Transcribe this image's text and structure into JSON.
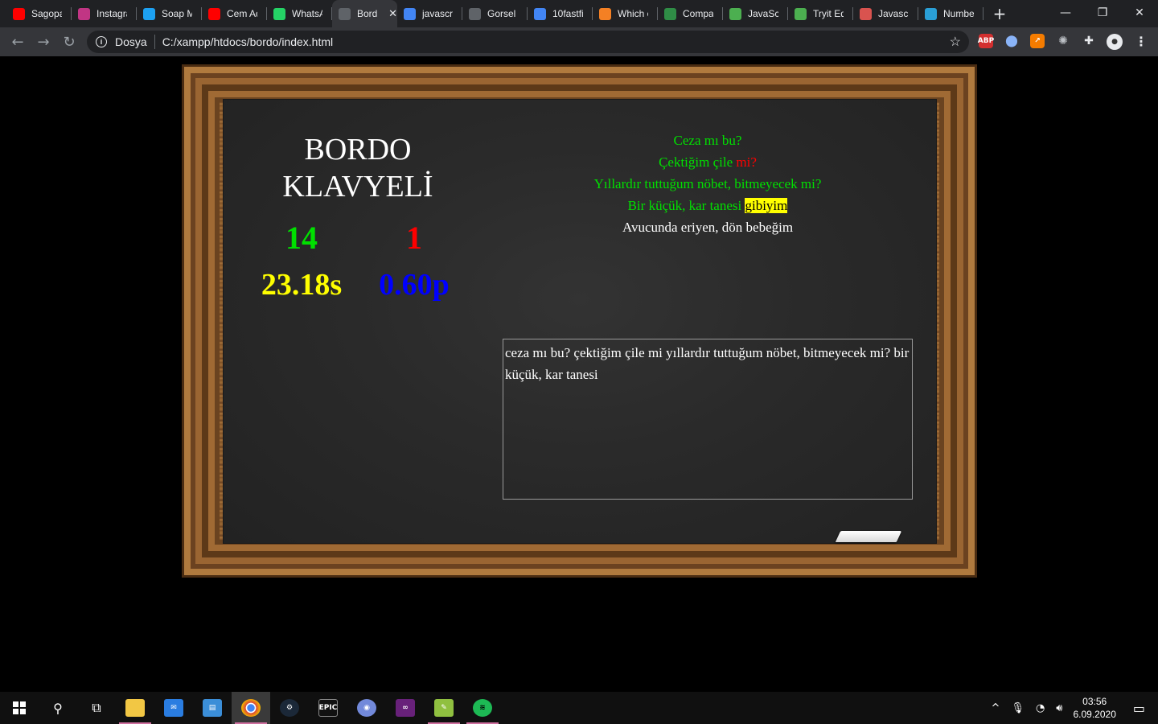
{
  "browser": {
    "tabs": [
      {
        "title": "Sagopa",
        "icon": "youtube-icon",
        "color": "#ff0000"
      },
      {
        "title": "Instagra",
        "icon": "instagram-icon",
        "color": "#c13584"
      },
      {
        "title": "Soap M",
        "icon": "twitter-icon",
        "color": "#1da1f2"
      },
      {
        "title": "Cem Ad",
        "icon": "youtube-icon",
        "color": "#ff0000"
      },
      {
        "title": "WhatsA",
        "icon": "whatsapp-icon",
        "color": "#25d366"
      },
      {
        "title": "Bord",
        "icon": "globe-icon",
        "color": "#5f6368",
        "active": true
      },
      {
        "title": "javascrip",
        "icon": "google-icon",
        "color": "#4285f4"
      },
      {
        "title": "Gorsel I",
        "icon": "globe-icon",
        "color": "#5f6368"
      },
      {
        "title": "10fastfi",
        "icon": "google-icon",
        "color": "#4285f4"
      },
      {
        "title": "Which c",
        "icon": "stackoverflow-icon",
        "color": "#f48024"
      },
      {
        "title": "Compa",
        "icon": "geeksforgeeks-icon",
        "color": "#2f8d46"
      },
      {
        "title": "JavaScri",
        "icon": "w3schools-icon",
        "color": "#4caf50"
      },
      {
        "title": "Tryit Ed",
        "icon": "w3schools-icon",
        "color": "#4caf50"
      },
      {
        "title": "Javascri",
        "icon": "tutorial-icon",
        "color": "#d9534f"
      },
      {
        "title": "Numbe",
        "icon": "numbers-icon",
        "color": "#2a9fd6"
      }
    ],
    "new_tab": "+",
    "window_controls": {
      "minimize": "—",
      "restore": "❐",
      "close": "✕"
    },
    "address": {
      "scheme_label": "Dosya",
      "url": "C:/xampp/htdocs/bordo/index.html"
    },
    "extensions": {
      "abp": "ABP"
    }
  },
  "game": {
    "title_line1": "BORDO",
    "title_line2": "KLAVYELİ",
    "correct_count": "14",
    "wrong_count": "1",
    "elapsed_time": "23.18s",
    "score": "0.60p"
  },
  "poem": {
    "line1": "Ceza mı bu?",
    "line2_a": "Çektiğim çile",
    "line2_b": "mi?",
    "line3": "Yıllardır tuttuğum nöbet, bitmeyecek mi?",
    "line4_a": "Bir küçük, kar tanesi",
    "line4_b": "gibiyim",
    "line5": "Avucunda eriyen, dön bebeğim"
  },
  "input": {
    "value": "ceza mı bu? çektiğim çile mi yıllardır tuttuğum nöbet, bitmeyecek mi? bir küçük, kar tanesi"
  },
  "colors": {
    "correct": "#00e000",
    "wrong": "#ff0000",
    "current_word_bg": "#ffff00",
    "time": "#ffff00",
    "score": "#0000ff"
  },
  "taskbar": {
    "items": [
      "start-icon",
      "search-icon",
      "task-view-icon",
      "file-explorer-icon",
      "mail-icon",
      "news-icon",
      "chrome-icon",
      "steam-icon",
      "epic-games-icon",
      "discord-icon",
      "visual-studio-icon",
      "notepadpp-icon",
      "spotify-icon"
    ],
    "epic_label": "EPIC",
    "time": "03:56",
    "date": "6.09.2020"
  }
}
